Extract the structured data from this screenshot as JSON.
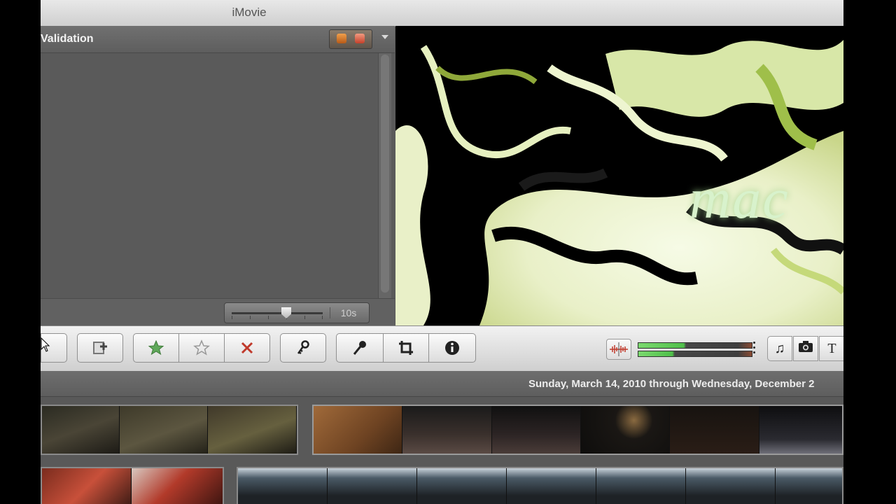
{
  "window": {
    "title": "iMovie"
  },
  "project": {
    "title": "Validation",
    "zoom_label": "10s",
    "zoom_level": 0.6
  },
  "viewer": {
    "overlay_text": "mac"
  },
  "toolbar": {
    "buttons": [
      {
        "name": "add-to-project",
        "icon": "filmstrip-add-icon"
      },
      {
        "name": "mark-favorite",
        "icon": "star-filled-icon"
      },
      {
        "name": "unmark",
        "icon": "star-outline-icon"
      },
      {
        "name": "reject",
        "icon": "x-icon"
      },
      {
        "name": "keyword",
        "icon": "key-icon"
      },
      {
        "name": "voiceover",
        "icon": "microphone-icon"
      },
      {
        "name": "crop",
        "icon": "crop-icon"
      },
      {
        "name": "inspector",
        "icon": "info-icon"
      }
    ],
    "audio_levels": [
      0.4,
      0.3
    ],
    "right_buttons": [
      {
        "name": "music",
        "icon": "music-note-icon",
        "glyph": "♫"
      },
      {
        "name": "photos",
        "icon": "camera-icon"
      },
      {
        "name": "titles",
        "icon": "title-text-icon",
        "glyph": "T"
      }
    ]
  },
  "event": {
    "date_range": "Sunday, March 14, 2010 through Wednesday, December 2"
  },
  "colors": {
    "accent_green": "#5fa85a",
    "reject_red": "#c0392b"
  }
}
